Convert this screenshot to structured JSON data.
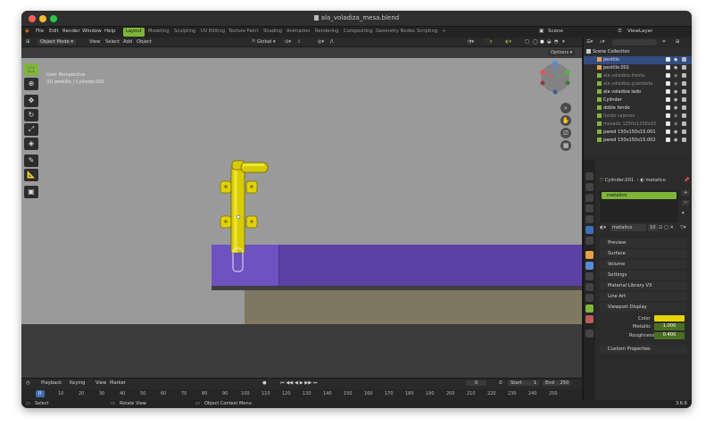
{
  "window": {
    "title": "ala_voladiza_mesa.blend"
  },
  "menu": {
    "items": [
      "File",
      "Edit",
      "Render",
      "Window",
      "Help"
    ]
  },
  "workspaces": [
    "Layout",
    "Modeling",
    "Sculpting",
    "UV Editing",
    "Texture Paint",
    "Shading",
    "Animation",
    "Rendering",
    "Compositing",
    "Geometry Nodes",
    "Scripting",
    "+"
  ],
  "scene": {
    "scene_label": "Scene",
    "viewlayer_label": "ViewLayer"
  },
  "header": {
    "mode": "Object Mode",
    "menus": [
      "View",
      "Select",
      "Add",
      "Object"
    ],
    "orientation": "Global"
  },
  "viewport": {
    "line1": "User Perspective",
    "line2": "(0) pestillo | Cylinder.001",
    "options": "Options"
  },
  "outliner": {
    "root": "Scene Collection",
    "items": [
      {
        "name": "pestillo",
        "selected": true
      },
      {
        "name": "pestillo.001",
        "selected": false
      },
      {
        "name": "ala voladiza frente",
        "selected": false
      },
      {
        "name": "ala voladiza guardada",
        "selected": false
      },
      {
        "name": "ala voladiza lado",
        "selected": false
      },
      {
        "name": "Cylinder",
        "selected": false
      },
      {
        "name": "doble fondo",
        "selected": false
      },
      {
        "name": "fondo cajones",
        "selected": false
      },
      {
        "name": "mesado 1250x1250x15",
        "selected": false
      },
      {
        "name": "pared 150x150x15.001",
        "selected": false
      },
      {
        "name": "pared 150x150x15.002",
        "selected": false
      }
    ]
  },
  "properties": {
    "breadcrumb_object": "Cylinder.001",
    "breadcrumb_material": "metalico",
    "slot_name": "metalico",
    "material_name": "metalico",
    "users": "10",
    "sections": [
      "Preview",
      "Surface",
      "Volume",
      "Settings",
      "Material Library VX",
      "Line Art",
      "Viewport Display"
    ],
    "viewport_display": {
      "color_label": "Color",
      "color_value": "#e8d400",
      "metallic_label": "Metallic",
      "metallic_value": "1.000",
      "roughness_label": "Roughness",
      "roughness_value": "0.400"
    },
    "custom_properties": "Custom Properties"
  },
  "timeline": {
    "menus": [
      "Playback",
      "Keying",
      "View",
      "Marker"
    ],
    "current_frame": "0",
    "start_label": "Start",
    "start_value": "1",
    "end_label": "End",
    "end_value": "250",
    "ticks": [
      "0",
      "10",
      "20",
      "30",
      "40",
      "50",
      "60",
      "70",
      "80",
      "90",
      "100",
      "110",
      "120",
      "130",
      "140",
      "150",
      "160",
      "170",
      "180",
      "190",
      "200",
      "210",
      "220",
      "230",
      "240",
      "250"
    ]
  },
  "statusbar": {
    "select": "Select",
    "rotate": "Rotate View",
    "context": "Object Context Menu",
    "version": "3.6.9"
  },
  "colors": {
    "accent": "#7fb53a",
    "selected_row": "#334d80",
    "table_purple": "#5b41a4",
    "brass": "#d4cc00"
  }
}
